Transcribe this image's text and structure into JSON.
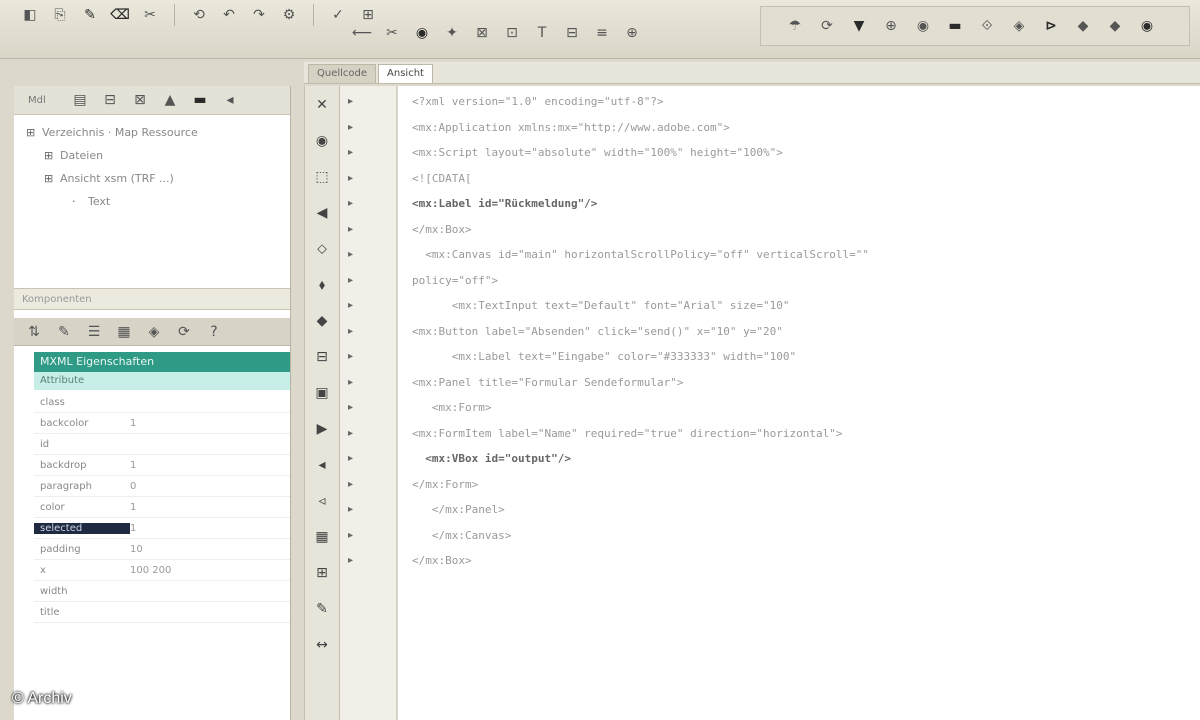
{
  "toolbar": {
    "row1": [
      "◧",
      "⎘",
      "✎",
      "⌫",
      "✂",
      "⟲",
      "↶",
      "↷",
      "⚙",
      "✓",
      "⊞"
    ],
    "row2": [
      "⟵",
      "✂",
      "◉",
      "✦",
      "⊠",
      "⊡",
      "T",
      "⊟",
      "≡",
      "⊕"
    ],
    "right": [
      "☂",
      "⟳",
      "▼",
      "⊕",
      "◉",
      "▬",
      "⟐",
      "◈",
      "⊳",
      "◆",
      "◆",
      "◉"
    ]
  },
  "tabs": [
    "Quellcode",
    "Ansicht"
  ],
  "tree": {
    "toolbar_label": "Mdl",
    "items": [
      {
        "text": "Verzeichnis · Map Ressource",
        "level": 0
      },
      {
        "text": "Dateien",
        "level": 1
      },
      {
        "text": "Ansicht xsm (TRF ...)",
        "level": 1
      },
      {
        "text": "Text",
        "level": 2
      }
    ],
    "strip_label": "Komponenten"
  },
  "props": {
    "header": "MXML Eigenschaften",
    "subheader": "Attribute",
    "rows": [
      {
        "key": "class",
        "value": ""
      },
      {
        "key": "backcolor",
        "value": "1"
      },
      {
        "key": "id",
        "value": ""
      },
      {
        "key": "backdrop",
        "value": "1"
      },
      {
        "key": "paragraph",
        "value": "0"
      },
      {
        "key": "color",
        "value": "1"
      },
      {
        "key": "selected",
        "value": "1"
      },
      {
        "key": "padding",
        "value": "10"
      },
      {
        "key": "x",
        "value": "100 200"
      },
      {
        "key": "width",
        "value": ""
      },
      {
        "key": "title",
        "value": ""
      }
    ]
  },
  "code": [
    {
      "text": "<?xml version=\"1.0\" encoding=\"utf-8\"?>",
      "indent": 0,
      "bold": false
    },
    {
      "text": "<mx:Application xmlns:mx=\"http://www.adobe.com\">",
      "indent": 0,
      "bold": false
    },
    {
      "text": "<mx:Script layout=\"absolute\" width=\"100%\" height=\"100%\">",
      "indent": 0,
      "bold": false
    },
    {
      "text": "<![CDATA[",
      "indent": 0,
      "bold": false
    },
    {
      "text": "<mx:Label id=\"Rückmeldung\"/>",
      "indent": 0,
      "bold": true
    },
    {
      "text": "</mx:Box>",
      "indent": 0,
      "bold": false
    },
    {
      "text": "  <mx:Canvas id=\"main\" horizontalScrollPolicy=\"off\" verticalScroll=\"\"",
      "indent": 0,
      "bold": false
    },
    {
      "text": "policy=\"off\">",
      "indent": 0,
      "bold": false
    },
    {
      "text": "      <mx:TextInput text=\"Default\" font=\"Arial\" size=\"10\"",
      "indent": 0,
      "bold": false
    },
    {
      "text": "<mx:Button label=\"Absenden\" click=\"send()\" x=\"10\" y=\"20\"",
      "indent": 0,
      "bold": false
    },
    {
      "text": "      <mx:Label text=\"Eingabe\" color=\"#333333\" width=\"100\"",
      "indent": 0,
      "bold": false
    },
    {
      "text": "<mx:Panel title=\"Formular Sendeformular\">",
      "indent": 0,
      "bold": false
    },
    {
      "text": "   <mx:Form>",
      "indent": 0,
      "bold": false
    },
    {
      "text": "<mx:FormItem label=\"Name\" required=\"true\" direction=\"horizontal\">",
      "indent": 0,
      "bold": false
    },
    {
      "text": "  <mx:VBox id=\"output\"/>",
      "indent": 0,
      "bold": true
    },
    {
      "text": "</mx:Form>",
      "indent": 0,
      "bold": false
    },
    {
      "text": "   </mx:Panel>",
      "indent": 0,
      "bold": false
    },
    {
      "text": "   </mx:Canvas>",
      "indent": 0,
      "bold": false
    },
    {
      "text": "</mx:Box>",
      "indent": 0,
      "bold": false
    }
  ],
  "gutter_marks": [
    "▸",
    "▸",
    "▸",
    "▸",
    "▸",
    "▸",
    "▸",
    "▸",
    "▸",
    "▸",
    "▸",
    "▸",
    "▸",
    "▸",
    "▸",
    "▸",
    "▸",
    "▸",
    "▸"
  ],
  "vtools": [
    "✕",
    "◉",
    "⬚",
    "◀",
    "⬦",
    "⬧",
    "◆",
    "⊟",
    "▣",
    "▶",
    "◂",
    "◃",
    "▦",
    "⊞",
    "✎",
    "↔"
  ],
  "watermark": "© Archiv"
}
